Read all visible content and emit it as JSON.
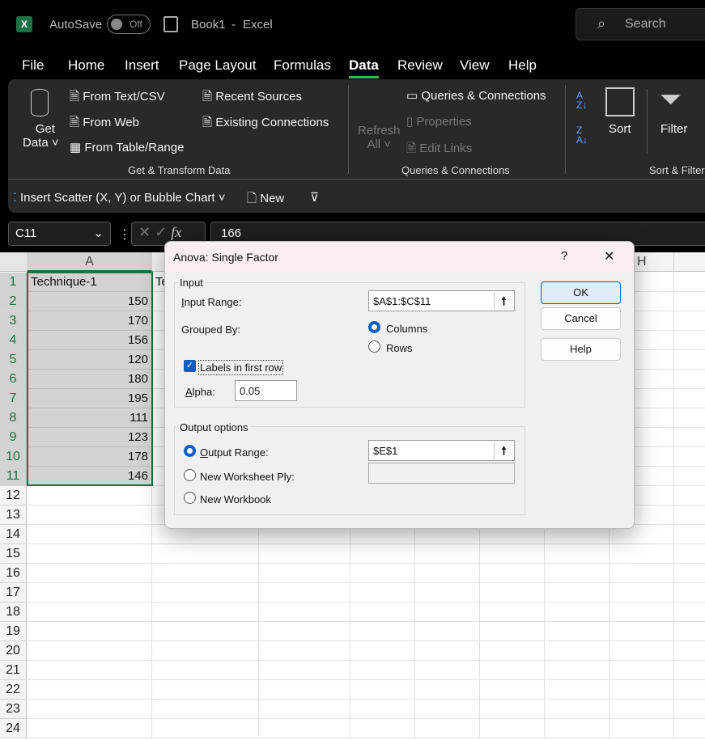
{
  "titlebar": {
    "autosave": "AutoSave",
    "toggle": "Off",
    "doc": "Book1",
    "sep": "-",
    "app": "Excel",
    "search": "Search"
  },
  "menu": [
    "File",
    "Home",
    "Insert",
    "Page Layout",
    "Formulas",
    "Data",
    "Review",
    "View",
    "Help"
  ],
  "active_tab": "Data",
  "accent": "#1e7145",
  "ribbon": {
    "get_data": [
      "Get",
      "Data ˅"
    ],
    "from_text": "From Text/CSV",
    "from_web": "From Web",
    "from_table": "From Table/Range",
    "recent": "Recent Sources",
    "existing": "Existing Connections",
    "group1": "Get & Transform Data",
    "refresh": [
      "Refresh",
      "All ˅"
    ],
    "queries": "Queries & Connections",
    "properties": "Properties",
    "edit_links": "Edit Links",
    "group2": "Queries & Connections",
    "sort": "Sort",
    "filter": "Filter",
    "group3": "Sort & Filter"
  },
  "qat": {
    "scatter": "Insert Scatter (X, Y) or Bubble Chart ˅",
    "new": "New",
    "more": "⊽"
  },
  "formula_bar": {
    "name_box": "C11",
    "value": "166",
    "fx": "fx"
  },
  "sheet": {
    "columns": [
      "A",
      "H"
    ],
    "rows": [
      "1",
      "2",
      "3",
      "4",
      "5",
      "6",
      "7",
      "8",
      "9",
      "10",
      "11",
      "12",
      "13",
      "14",
      "15",
      "16",
      "17",
      "18",
      "19",
      "20",
      "21",
      "22",
      "23",
      "24"
    ],
    "a_header": "Technique-1",
    "b_partial": "Te",
    "a_values": [
      "150",
      "170",
      "156",
      "120",
      "180",
      "195",
      "111",
      "123",
      "178",
      "146"
    ]
  },
  "dialog": {
    "title": "Anova: Single Factor",
    "help": "?",
    "close": "✕",
    "input_legend": "Input",
    "input_range_label": "Input Range:",
    "input_range": "$A$1:$C$11",
    "grouped_by": "Grouped By:",
    "columns": "Columns",
    "rows": "Rows",
    "grouped_value": "Columns",
    "labels": "Labels in first row",
    "labels_checked": true,
    "alpha_label": "Alpha:",
    "alpha": "0.05",
    "output_legend": "Output options",
    "output_range_label": "Output Range:",
    "output_range": "$E$1",
    "new_ply": "New Worksheet Ply:",
    "new_ply_value": "",
    "new_wb": "New Workbook",
    "output_selected": "Output Range",
    "ok": "OK",
    "cancel": "Cancel",
    "help_btn": "Help"
  }
}
